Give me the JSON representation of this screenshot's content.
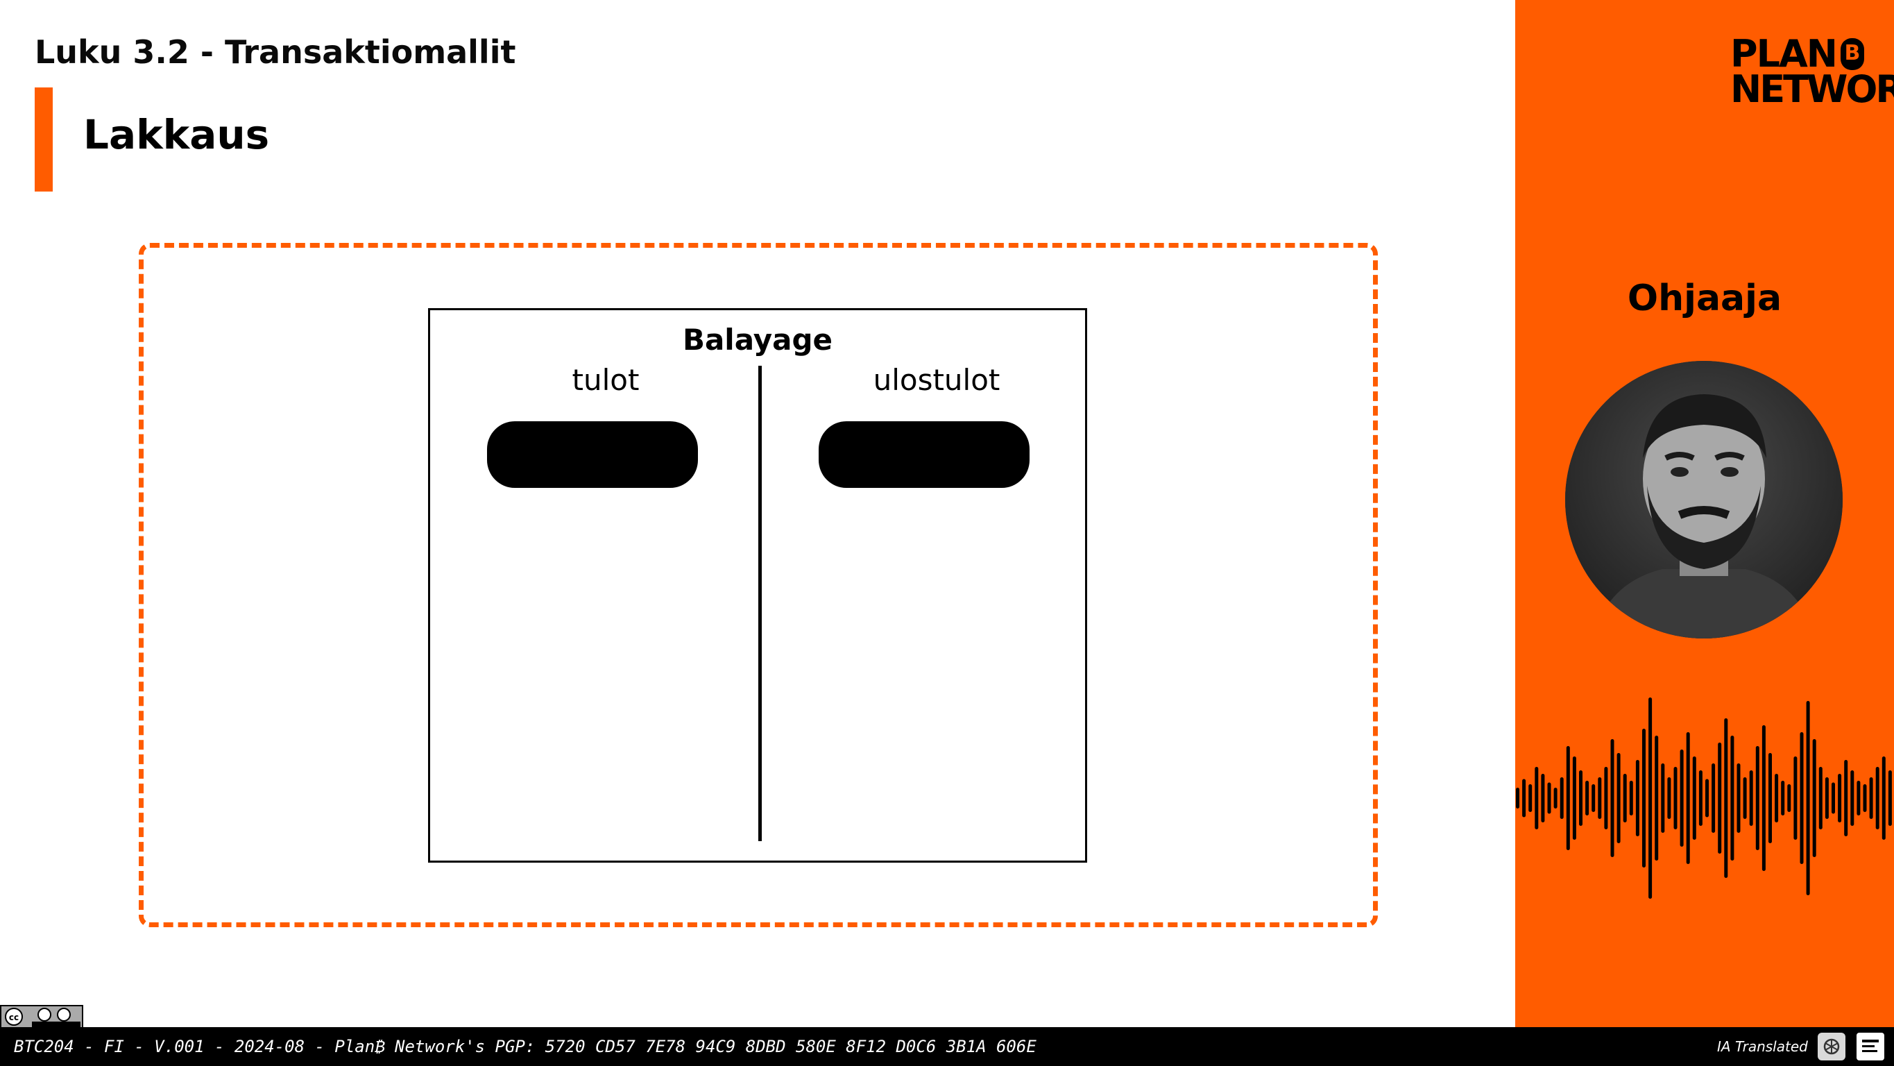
{
  "header": {
    "chapter": "Luku 3.2 - Transaktiomallit",
    "section": "Lakkaus"
  },
  "diagram": {
    "title": "Balayage",
    "inputs_label": "tulot",
    "outputs_label": "ulostulot"
  },
  "side_panel": {
    "logo_line1": "PLAN",
    "logo_line2": "NETWORK",
    "logo_mark": "B",
    "instructor_label": "Ohjaaja",
    "avatar_icon": "instructor-portrait"
  },
  "footer": {
    "text": "BTC204 - FI - V.001 - 2024-08 - Plan₿ Network's PGP: 5720 CD57 7E78 94C9 8DBD 580E 8F12 D0C6 3B1A 606E",
    "ia_text": "IA Translated",
    "license_icon": "cc-by-sa-icon"
  },
  "colors": {
    "accent": "#ff5c00",
    "black": "#000000",
    "white": "#ffffff"
  }
}
